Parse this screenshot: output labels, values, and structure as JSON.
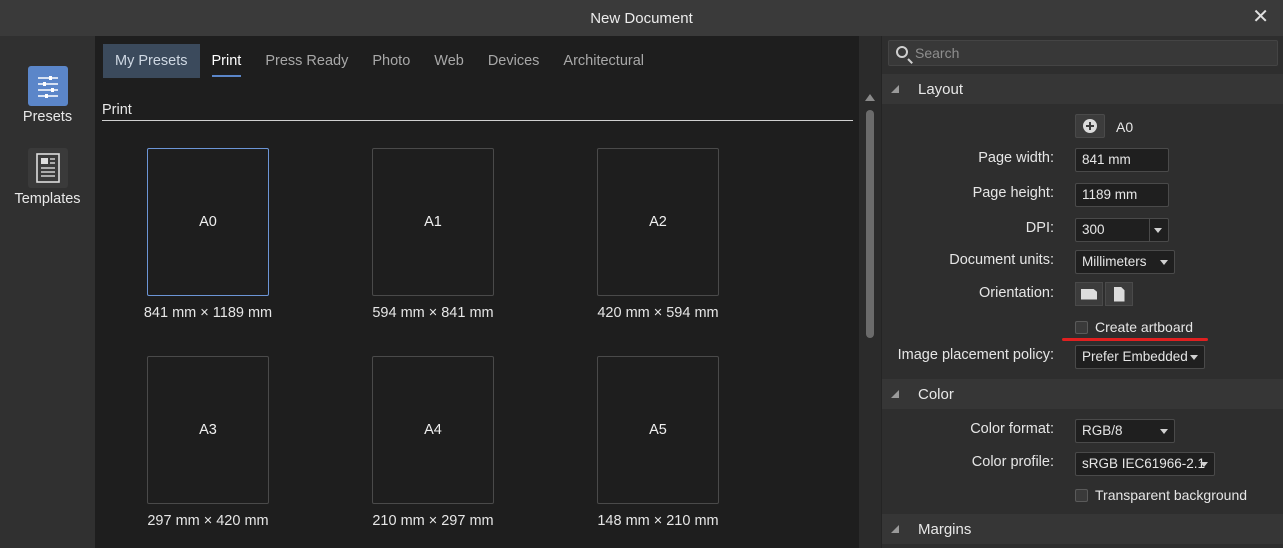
{
  "window": {
    "title": "New Document",
    "close_glyph": "✕"
  },
  "sidebar": {
    "items": [
      {
        "label": "Presets",
        "icon": "sliders-icon"
      },
      {
        "label": "Templates",
        "icon": "document-icon"
      }
    ]
  },
  "tabs": [
    "My Presets",
    "Print",
    "Press Ready",
    "Photo",
    "Web",
    "Devices",
    "Architectural"
  ],
  "section": {
    "title": "Print"
  },
  "presets": [
    {
      "name": "A0",
      "dims": "841 mm × 1189 mm"
    },
    {
      "name": "A1",
      "dims": "594 mm × 841 mm"
    },
    {
      "name": "A2",
      "dims": "420 mm × 594 mm"
    },
    {
      "name": "A3",
      "dims": "297 mm × 420 mm"
    },
    {
      "name": "A4",
      "dims": "210 mm × 297 mm"
    },
    {
      "name": "A5",
      "dims": "148 mm × 210 mm"
    }
  ],
  "search": {
    "placeholder": "Search"
  },
  "layout": {
    "title": "Layout",
    "preset_name": "A0",
    "page_width_label": "Page width:",
    "page_width": "841 mm",
    "page_height_label": "Page height:",
    "page_height": "1189 mm",
    "dpi_label": "DPI:",
    "dpi": "300",
    "units_label": "Document units:",
    "units": "Millimeters",
    "orientation_label": "Orientation:",
    "create_artboard": "Create artboard",
    "placement_label": "Image placement policy:",
    "placement": "Prefer Embedded"
  },
  "color": {
    "title": "Color",
    "format_label": "Color format:",
    "format": "RGB/8",
    "profile_label": "Color profile:",
    "profile": "sRGB IEC61966-2.1",
    "transparent": "Transparent background"
  },
  "margins": {
    "title": "Margins"
  },
  "accent_color": "#5b86c9",
  "highlight_color": "#e02020"
}
